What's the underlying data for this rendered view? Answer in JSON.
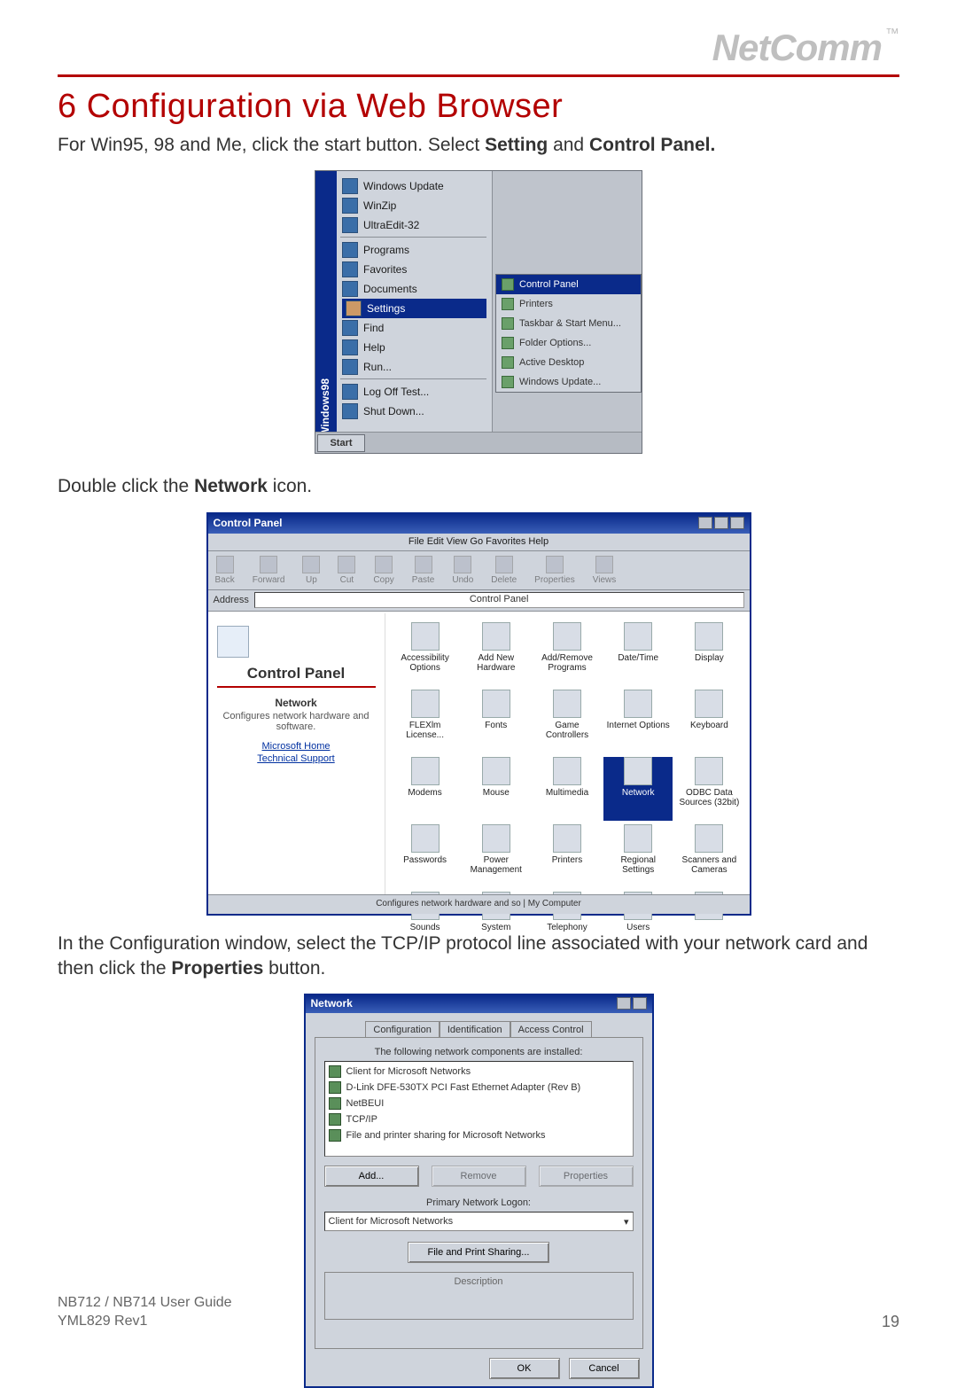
{
  "logo": {
    "text": "NetComm",
    "tm": "™"
  },
  "section": {
    "number": "6",
    "title": "Configuration via Web Browser"
  },
  "p1_a": "For Win95, 98 and Me, click the start button. Select ",
  "p1_b": "Setting",
  "p1_c": " and ",
  "p1_d": "Control Panel.",
  "p2_a": "Double click the ",
  "p2_b": "Network",
  "p2_c": " icon.",
  "p3_a": "In the Configuration window, select the TCP/IP protocol line associated with your network card and then click the ",
  "p3_b": "Properties",
  "p3_c": " button.",
  "startmenu": {
    "sidebar": "Windows98",
    "top": [
      "Windows Update",
      "WinZip",
      "UltraEdit-32"
    ],
    "mid": [
      "Programs",
      "Favorites",
      "Documents"
    ],
    "settings": "Settings",
    "below": [
      "Find",
      "Help",
      "Run..."
    ],
    "bottom": [
      "Log Off Test...",
      "Shut Down..."
    ],
    "fly_hl": "Control Panel",
    "fly": [
      "Printers",
      "Taskbar & Start Menu...",
      "Folder Options...",
      "Active Desktop",
      "Windows Update..."
    ],
    "start": "Start"
  },
  "cpanel": {
    "title": "Control Panel",
    "menus": "File   Edit   View   Go   Favorites   Help",
    "toolbar": [
      "Back",
      "Forward",
      "Up",
      "Cut",
      "Copy",
      "Paste",
      "Undo",
      "Delete",
      "Properties",
      "Views"
    ],
    "address_label": "Address",
    "address_value": "Control Panel",
    "left_title": "Control Panel",
    "left_h": "Network",
    "left_sub": "Configures network hardware and software.",
    "left_link1": "Microsoft Home",
    "left_link2": "Technical Support",
    "icons": [
      "Accessibility Options",
      "Add New Hardware",
      "Add/Remove Programs",
      "Date/Time",
      "Display",
      "FLEXlm License...",
      "Fonts",
      "Game Controllers",
      "Internet Options",
      "Keyboard",
      "Modems",
      "Mouse",
      "Multimedia",
      "Network",
      "ODBC Data Sources (32bit)",
      "Passwords",
      "Power Management",
      "Printers",
      "Regional Settings",
      "Scanners and Cameras",
      "Sounds",
      "System",
      "Telephony",
      "Users",
      ""
    ],
    "highlight_index": 13,
    "status": "Configures network hardware and so   |   My Computer"
  },
  "network": {
    "title": "Network",
    "tabs": [
      "Configuration",
      "Identification",
      "Access Control"
    ],
    "list_label": "The following network components are installed:",
    "list": [
      "Client for Microsoft Networks",
      "D-Link DFE-530TX PCI Fast Ethernet Adapter (Rev B)",
      "NetBEUI",
      "TCP/IP",
      "File and printer sharing for Microsoft Networks"
    ],
    "btn_add": "Add...",
    "btn_remove": "Remove",
    "btn_props": "Properties",
    "logon_label": "Primary Network Logon:",
    "logon_value": "Client for Microsoft Networks",
    "fps_btn": "File and Print Sharing...",
    "desc_label": "Description",
    "ok": "OK",
    "cancel": "Cancel"
  },
  "footer": {
    "line1": "NB712 / NB714 User Guide",
    "line2": "YML829 Rev1",
    "page": "19"
  }
}
